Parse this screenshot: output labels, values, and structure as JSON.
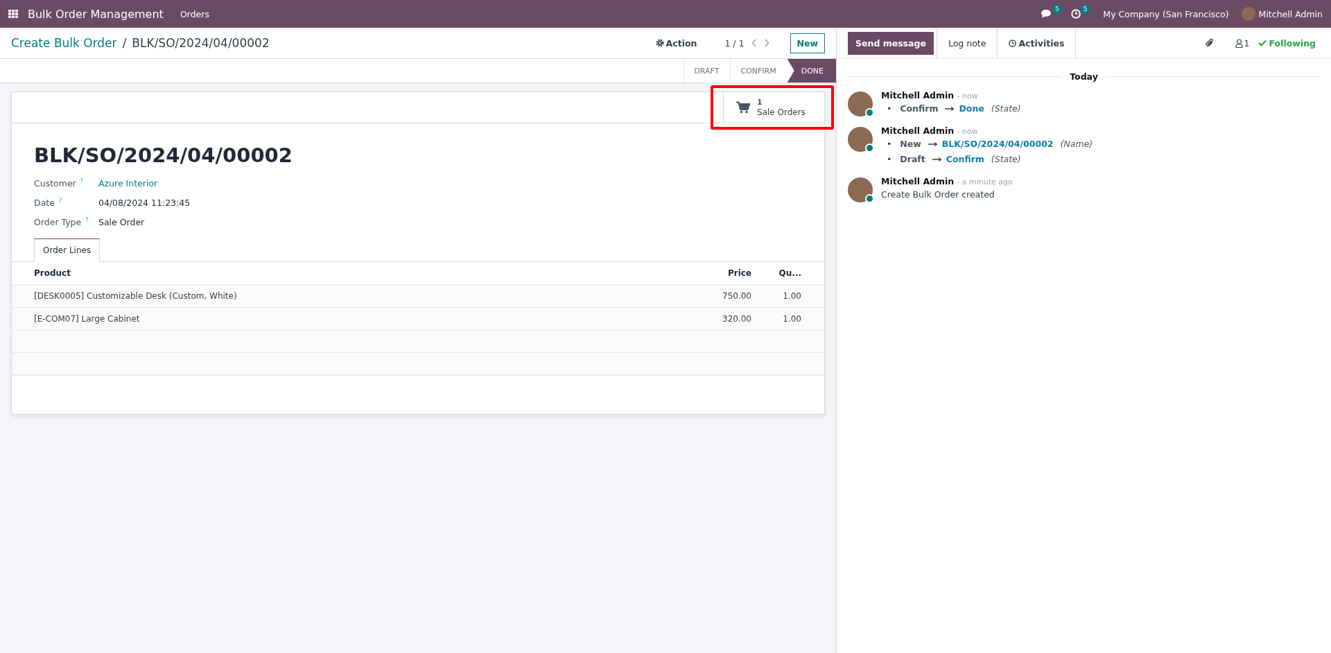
{
  "navbar": {
    "app_name": "Bulk Order Management",
    "menu": [
      "Orders"
    ],
    "messages_count": "5",
    "activities_count": "5",
    "company": "My Company (San Francisco)",
    "user": "Mitchell Admin"
  },
  "control_panel": {
    "breadcrumb_parent": "Create Bulk Order",
    "breadcrumb_separator": "/",
    "breadcrumb_current": "BLK/SO/2024/04/00002",
    "action": "Action",
    "pager": "1 / 1",
    "new_button": "New"
  },
  "statusbar": [
    {
      "label": "DRAFT",
      "selected": false
    },
    {
      "label": "CONFIRM",
      "selected": false
    },
    {
      "label": "DONE",
      "selected": true
    }
  ],
  "smart_button": {
    "count": "1",
    "label": "Sale Orders",
    "highlighted": true
  },
  "form": {
    "title": "BLK/SO/2024/04/00002",
    "fields": [
      {
        "label": "Customer",
        "help": "?",
        "value": "Azure Interior",
        "kind": "link"
      },
      {
        "label": "Date",
        "help": "?",
        "value": "04/08/2024 11:23:45",
        "kind": "text"
      },
      {
        "label": "Order Type",
        "help": "?",
        "value": "Sale Order",
        "kind": "text"
      }
    ],
    "tabs": [
      {
        "label": "Order Lines",
        "selected": true
      }
    ],
    "table": {
      "columns": [
        "Product",
        "Price",
        "Qu..."
      ],
      "rows": [
        [
          "[DESK0005] Customizable Desk (Custom, White)",
          "750.00",
          "1.00"
        ],
        [
          "[E-COM07] Large Cabinet",
          "320.00",
          "1.00"
        ]
      ]
    }
  },
  "chatter": {
    "send_message": "Send message",
    "log_note": "Log note",
    "activities": "Activities",
    "followers_count": "1",
    "following": "Following",
    "date_separator": "Today",
    "messages": [
      {
        "kind": "tracking",
        "author": "Mitchell Admin",
        "time": "- now",
        "changes": [
          {
            "bullet": "•",
            "old": "Confirm",
            "new": "Done",
            "field": "(State)"
          }
        ]
      },
      {
        "kind": "tracking",
        "author": "Mitchell Admin",
        "time": "- now",
        "changes": [
          {
            "bullet": "•",
            "old": "New",
            "new": "BLK/SO/2024/04/00002",
            "field": "(Name)"
          },
          {
            "bullet": "•",
            "old": "Draft",
            "new": "Confirm",
            "field": "(State)"
          }
        ]
      },
      {
        "kind": "note",
        "author": "Mitchell Admin",
        "time": "- a minute ago",
        "body": "Create Bulk Order created"
      }
    ]
  }
}
